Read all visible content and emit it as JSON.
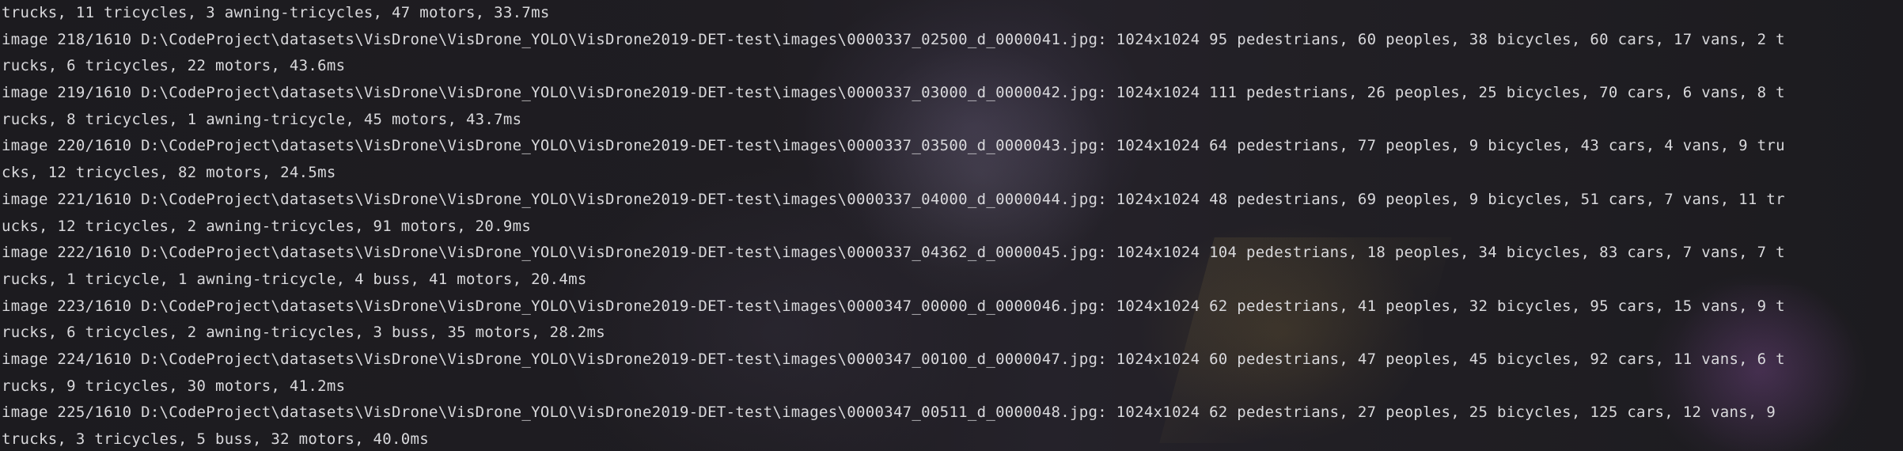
{
  "console": {
    "lines": [
      "trucks, 11 tricycles, 3 awning-tricycles, 47 motors, 33.7ms",
      "image 218/1610 D:\\CodeProject\\datasets\\VisDrone\\VisDrone_YOLO\\VisDrone2019-DET-test\\images\\0000337_02500_d_0000041.jpg: 1024x1024 95 pedestrians, 60 peoples, 38 bicycles, 60 cars, 17 vans, 2 t",
      "rucks, 6 tricycles, 22 motors, 43.6ms",
      "image 219/1610 D:\\CodeProject\\datasets\\VisDrone\\VisDrone_YOLO\\VisDrone2019-DET-test\\images\\0000337_03000_d_0000042.jpg: 1024x1024 111 pedestrians, 26 peoples, 25 bicycles, 70 cars, 6 vans, 8 t",
      "rucks, 8 tricycles, 1 awning-tricycle, 45 motors, 43.7ms",
      "image 220/1610 D:\\CodeProject\\datasets\\VisDrone\\VisDrone_YOLO\\VisDrone2019-DET-test\\images\\0000337_03500_d_0000043.jpg: 1024x1024 64 pedestrians, 77 peoples, 9 bicycles, 43 cars, 4 vans, 9 tru",
      "cks, 12 tricycles, 82 motors, 24.5ms",
      "image 221/1610 D:\\CodeProject\\datasets\\VisDrone\\VisDrone_YOLO\\VisDrone2019-DET-test\\images\\0000337_04000_d_0000044.jpg: 1024x1024 48 pedestrians, 69 peoples, 9 bicycles, 51 cars, 7 vans, 11 tr",
      "ucks, 12 tricycles, 2 awning-tricycles, 91 motors, 20.9ms",
      "image 222/1610 D:\\CodeProject\\datasets\\VisDrone\\VisDrone_YOLO\\VisDrone2019-DET-test\\images\\0000337_04362_d_0000045.jpg: 1024x1024 104 pedestrians, 18 peoples, 34 bicycles, 83 cars, 7 vans, 7 t",
      "rucks, 1 tricycle, 1 awning-tricycle, 4 buss, 41 motors, 20.4ms",
      "image 223/1610 D:\\CodeProject\\datasets\\VisDrone\\VisDrone_YOLO\\VisDrone2019-DET-test\\images\\0000347_00000_d_0000046.jpg: 1024x1024 62 pedestrians, 41 peoples, 32 bicycles, 95 cars, 15 vans, 9 t",
      "rucks, 6 tricycles, 2 awning-tricycles, 3 buss, 35 motors, 28.2ms",
      "image 224/1610 D:\\CodeProject\\datasets\\VisDrone\\VisDrone_YOLO\\VisDrone2019-DET-test\\images\\0000347_00100_d_0000047.jpg: 1024x1024 60 pedestrians, 47 peoples, 45 bicycles, 92 cars, 11 vans, 6 t",
      "rucks, 9 tricycles, 30 motors, 41.2ms",
      "image 225/1610 D:\\CodeProject\\datasets\\VisDrone\\VisDrone_YOLO\\VisDrone2019-DET-test\\images\\0000347_00511_d_0000048.jpg: 1024x1024 62 pedestrians, 27 peoples, 25 bicycles, 125 cars, 12 vans, 9",
      "trucks, 3 tricycles, 5 buss, 32 motors, 40.0ms"
    ]
  }
}
